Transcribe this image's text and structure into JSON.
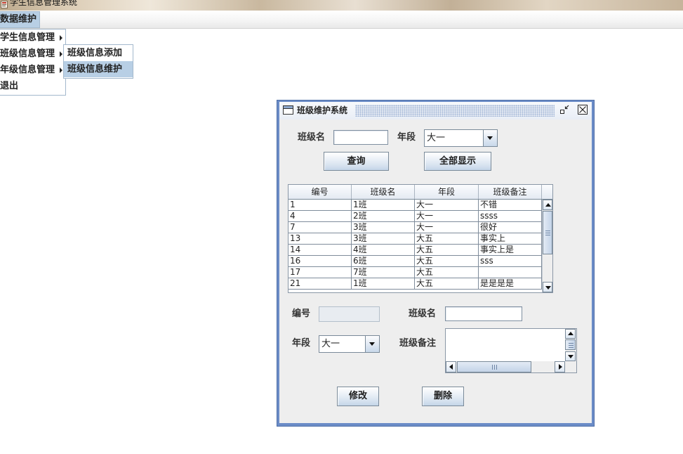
{
  "app": {
    "title": "学生信息管理系统"
  },
  "menubar": {
    "menus": [
      {
        "label": "数据维护",
        "selected": true
      }
    ]
  },
  "menu_popup": {
    "items": [
      {
        "label": "学生信息管理",
        "has_submenu": true,
        "selected": false
      },
      {
        "label": "班级信息管理",
        "has_submenu": true,
        "selected": false
      },
      {
        "label": "年级信息管理",
        "has_submenu": true,
        "selected": false
      },
      {
        "label": "退出",
        "has_submenu": false,
        "selected": false
      }
    ]
  },
  "submenu": {
    "items": [
      {
        "label": "班级信息添加",
        "selected": false
      },
      {
        "label": "班级信息维护",
        "selected": true
      }
    ]
  },
  "frame": {
    "title": "班级维护系统",
    "search": {
      "class_name_label": "班级名",
      "class_name_value": "",
      "grade_label": "年段",
      "grade_value": "大一",
      "query_button": "查询",
      "show_all_button": "全部显示"
    },
    "table": {
      "columns": [
        "编号",
        "班级名",
        "年段",
        "班级备注"
      ],
      "rows": [
        [
          "1",
          "1班",
          "大一",
          "不错"
        ],
        [
          "4",
          "2班",
          "大一",
          "ssss"
        ],
        [
          "7",
          "3班",
          "大一",
          "很好"
        ],
        [
          "13",
          "3班",
          "大五",
          "事实上"
        ],
        [
          "14",
          "4班",
          "大五",
          "事实上是"
        ],
        [
          "16",
          "6班",
          "大五",
          "sss"
        ],
        [
          "17",
          "7班",
          "大五",
          ""
        ],
        [
          "21",
          "1班",
          "大五",
          "是是是是"
        ]
      ]
    },
    "edit": {
      "id_label": "编号",
      "id_value": "",
      "class_name_label": "班级名",
      "class_name_value": "",
      "grade_label": "年段",
      "grade_value": "大一",
      "remark_label": "班级备注",
      "remark_value": "",
      "modify_button": "修改",
      "delete_button": "删除"
    }
  },
  "icons": {
    "app": "app-icon",
    "frame": "window-icon",
    "iconify": "iconify-icon",
    "close": "close-icon",
    "submenu_arrow": "triangle-right-icon",
    "combo_arrow": "triangle-down-icon"
  },
  "colors": {
    "menu_selection": "#b8cfe5",
    "frame_border": "#6b8cc7",
    "panel_background": "#eeeeee",
    "control_border": "#7a8a99"
  }
}
